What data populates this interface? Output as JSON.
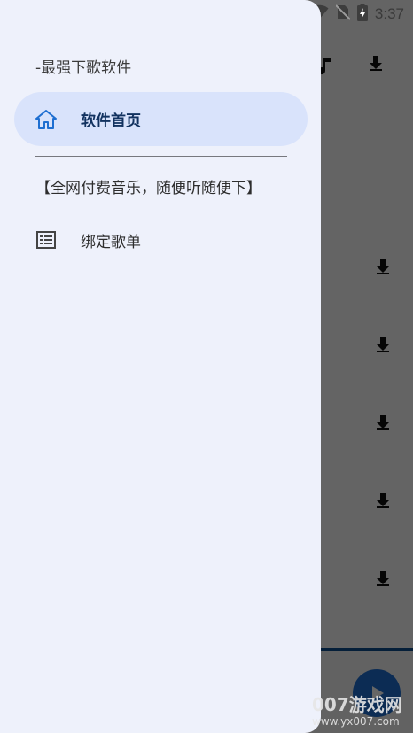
{
  "status_bar": {
    "time": "3:37"
  },
  "drawer": {
    "subtitle": "-最强下歌软件",
    "items": [
      {
        "label": "软件首页",
        "icon": "home-icon",
        "active": true
      },
      {
        "label": "绑定歌单",
        "icon": "list-icon",
        "active": false
      }
    ],
    "promo_text": "【全网付费音乐，随便听随便下】"
  },
  "watermark": {
    "brand": "007游戏网",
    "url": "www.yx007.com"
  },
  "colors": {
    "accent": "#1f6fd1",
    "active_pill": "#d9e3fb",
    "drawer_bg": "#eef1fb",
    "bottom_bar_accent": "#0d4f8f"
  }
}
